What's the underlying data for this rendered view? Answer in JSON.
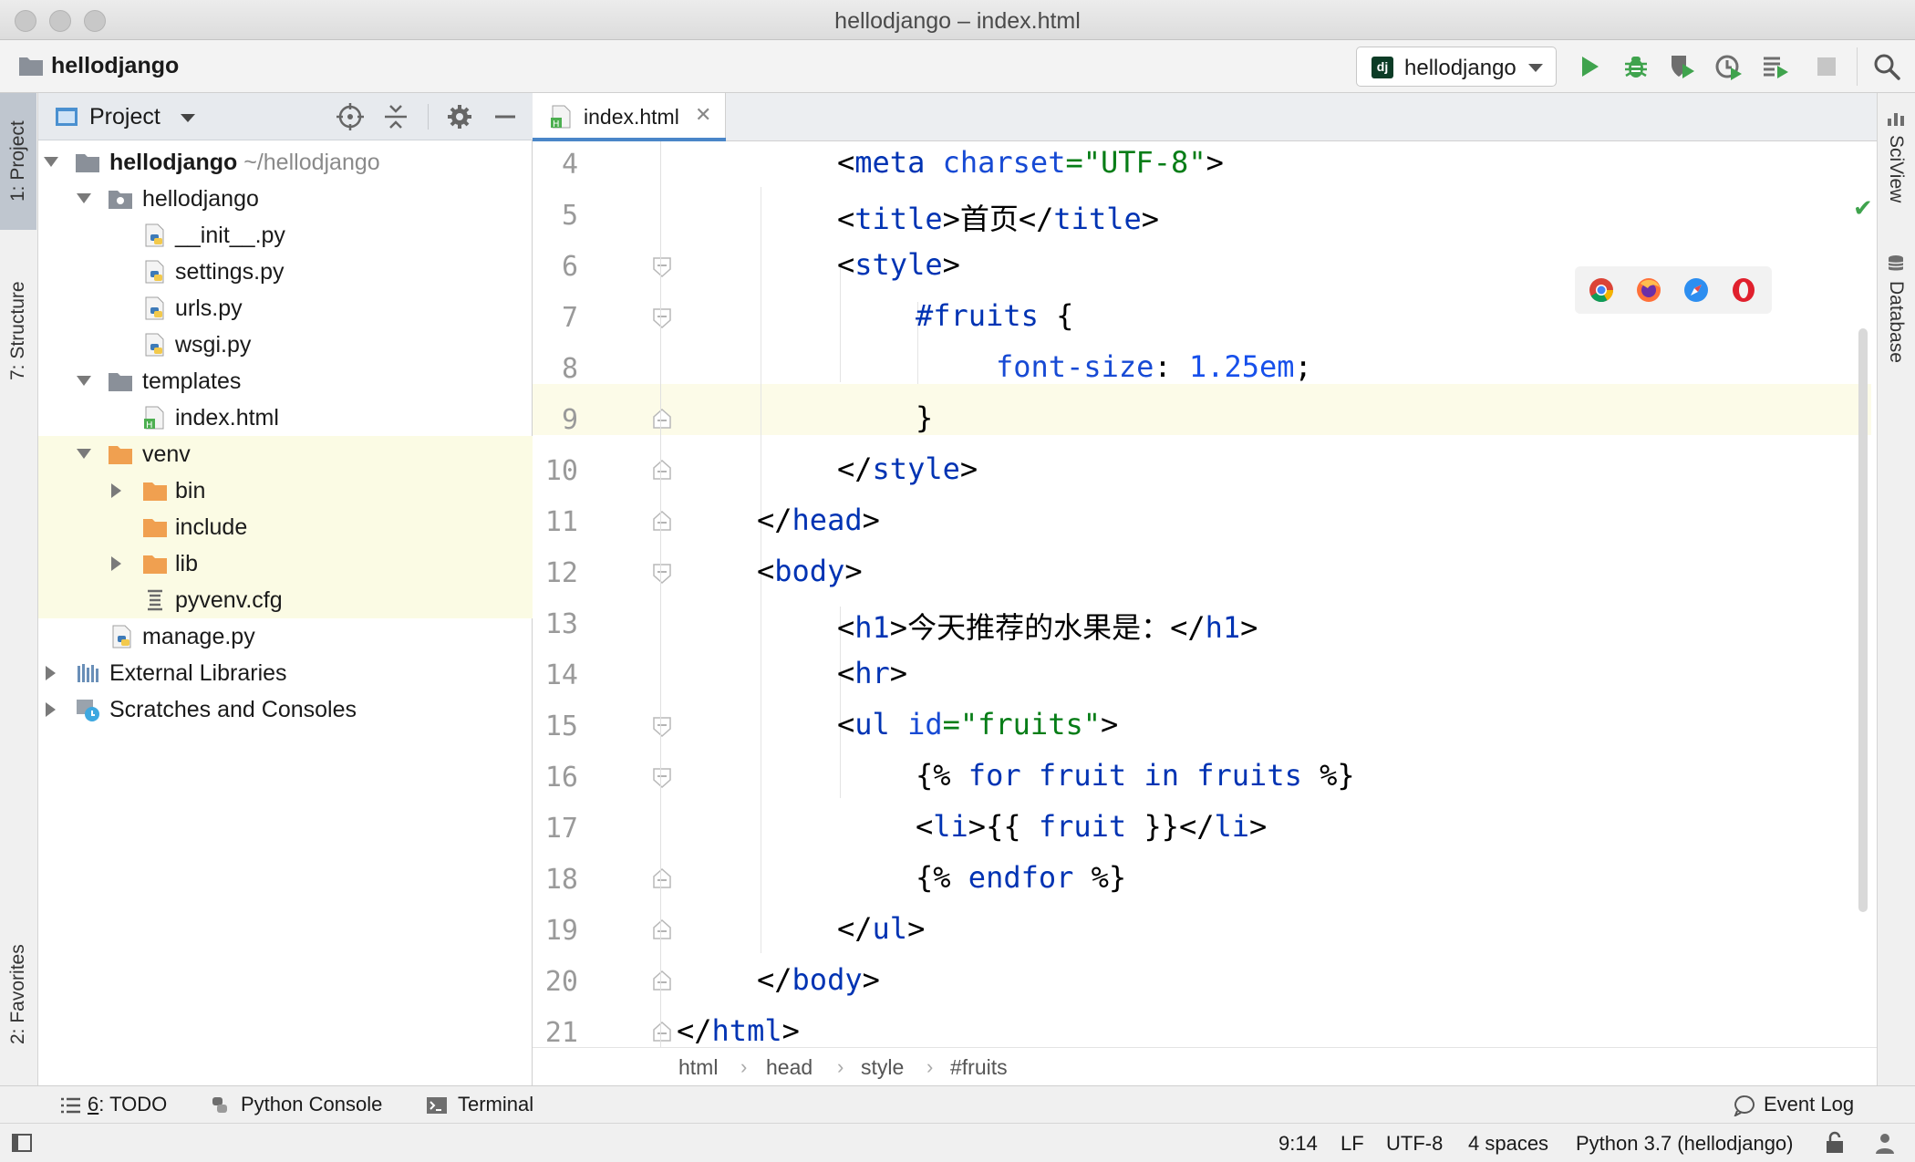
{
  "window": {
    "title": "hellodjango – index.html"
  },
  "navbar": {
    "project": "hellodjango",
    "run_config": {
      "badge": "dj",
      "label": "hellodjango"
    }
  },
  "left_tabs": {
    "project": "1: Project",
    "structure": "7: Structure",
    "favorites": "2: Favorites"
  },
  "right_tabs": {
    "sciview": "SciView",
    "database": "Database"
  },
  "project_panel": {
    "title": "Project",
    "tree": [
      {
        "label": "hellodjango",
        "sub": "~/hellodjango",
        "icon": "folder-icon"
      },
      {
        "label": "hellodjango",
        "icon": "package-folder-icon"
      },
      {
        "label": "__init__.py",
        "icon": "python-file-icon"
      },
      {
        "label": "settings.py",
        "icon": "python-file-icon"
      },
      {
        "label": "urls.py",
        "icon": "python-file-icon"
      },
      {
        "label": "wsgi.py",
        "icon": "python-file-icon"
      },
      {
        "label": "templates",
        "icon": "folder-icon"
      },
      {
        "label": "index.html",
        "icon": "html-file-icon"
      },
      {
        "label": "venv",
        "icon": "excluded-folder-icon"
      },
      {
        "label": "bin",
        "icon": "excluded-folder-icon"
      },
      {
        "label": "include",
        "icon": "excluded-folder-icon"
      },
      {
        "label": "lib",
        "icon": "excluded-folder-icon"
      },
      {
        "label": "pyvenv.cfg",
        "icon": "config-file-icon"
      },
      {
        "label": "manage.py",
        "icon": "python-file-icon"
      },
      {
        "label": "External Libraries",
        "icon": "libraries-icon"
      },
      {
        "label": "Scratches and Consoles",
        "icon": "scratches-icon"
      }
    ]
  },
  "editor": {
    "tab_label": "index.html",
    "line_numbers": [
      "4",
      "5",
      "6",
      "7",
      "8",
      "9",
      "10",
      "11",
      "12",
      "13",
      "14",
      "15",
      "16",
      "17",
      "18",
      "19",
      "20",
      "21"
    ],
    "code": {
      "l4": [
        "<",
        "meta",
        " ",
        "charset",
        "=",
        "\"UTF-8\"",
        ">"
      ],
      "l5": [
        "<",
        "title",
        ">首页</",
        "title",
        ">"
      ],
      "l6": [
        "<",
        "style",
        ">"
      ],
      "l7": [
        "#fruits",
        " {"
      ],
      "l8": [
        "font-size",
        ": ",
        "1.25em",
        ";"
      ],
      "l9": [
        "}"
      ],
      "l10": [
        "</",
        "style",
        ">"
      ],
      "l11": [
        "</",
        "head",
        ">"
      ],
      "l12": [
        "<",
        "body",
        ">"
      ],
      "l13": [
        "<",
        "h1",
        ">今天推荐的水果是：</",
        "h1",
        ">"
      ],
      "l14": [
        "<",
        "hr",
        ">"
      ],
      "l15": [
        "<",
        "ul",
        " ",
        "id",
        "=",
        "\"fruits\"",
        ">"
      ],
      "l16": [
        "{%",
        " ",
        "for",
        " ",
        "fruit",
        " ",
        "in",
        " ",
        "fruits",
        " ",
        "%}"
      ],
      "l17": [
        "<",
        "li",
        ">{{ ",
        "fruit",
        " }}</",
        "li",
        ">"
      ],
      "l18": [
        "{%",
        " ",
        "endfor",
        " ",
        "%}"
      ],
      "l19": [
        "</",
        "ul",
        ">"
      ],
      "l20": [
        "</",
        "body",
        ">"
      ],
      "l21": [
        "</",
        "html",
        ">"
      ]
    },
    "breadcrumb": [
      "html",
      "head",
      "style",
      "#fruits"
    ]
  },
  "tool_windows": {
    "todo_mnemonic": "6",
    "todo": ": TODO",
    "python_console": "Python Console",
    "terminal": "Terminal",
    "event_log": "Event Log"
  },
  "status": {
    "position": "9:14",
    "line_sep": "LF",
    "encoding": "UTF-8",
    "indent": "4 spaces",
    "interpreter": "Python 3.7 (hellodjango)"
  },
  "colors": {
    "accent": "#4a86c8",
    "run_green": "#3fa34d",
    "tag_blue": "#0033b3",
    "string_green": "#067d17",
    "excluded_folder": "#f0a050",
    "current_line": "#fcfbe8"
  }
}
